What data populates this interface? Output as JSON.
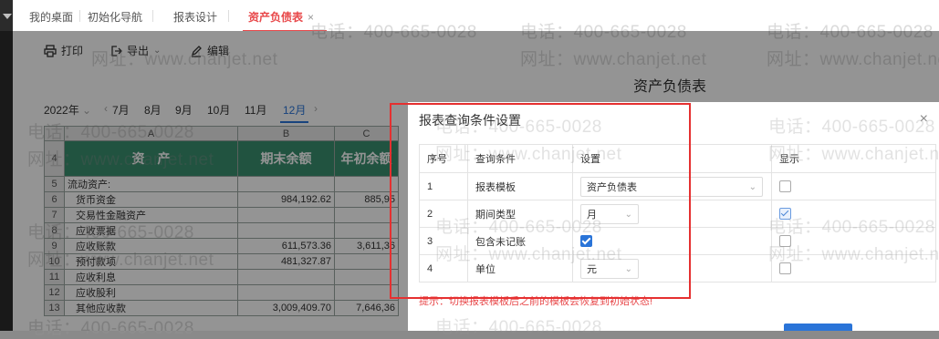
{
  "tabs": [
    {
      "label": "我的桌面"
    },
    {
      "label": "初始化导航"
    },
    {
      "label": "报表设计"
    },
    {
      "label": "资产负债表",
      "close": "×"
    }
  ],
  "toolbar": {
    "print_label": "打印",
    "export_label": "导出",
    "export_caret": "⌄",
    "edit_label": "编辑"
  },
  "report": {
    "title": "资产负债表"
  },
  "periods": {
    "year": "2022年",
    "year_caret": "⌄",
    "prev": "‹",
    "next": "›",
    "months": [
      "7月",
      "8月",
      "9月",
      "10月",
      "11月",
      "12月"
    ],
    "active_month": "12月"
  },
  "sheet": {
    "columns": [
      "A",
      "B",
      "C"
    ],
    "header_row_num": "4",
    "header": [
      "资　产",
      "期末余额",
      "年初余额"
    ],
    "rows": [
      {
        "num": "5",
        "a": "流动资产:",
        "b": "",
        "c": ""
      },
      {
        "num": "6",
        "a": "货币资金",
        "b": "984,192.62",
        "c": "885,95"
      },
      {
        "num": "7",
        "a": "交易性金融资产",
        "b": "",
        "c": ""
      },
      {
        "num": "8",
        "a": "应收票据",
        "b": "",
        "c": ""
      },
      {
        "num": "9",
        "a": "应收账款",
        "b": "611,573.36",
        "c": "3,611,36"
      },
      {
        "num": "10",
        "a": "预付款项",
        "b": "481,327.87",
        "c": ""
      },
      {
        "num": "11",
        "a": "应收利息",
        "b": "",
        "c": ""
      },
      {
        "num": "12",
        "a": "应收股利",
        "b": "",
        "c": ""
      },
      {
        "num": "13",
        "a": "其他应收款",
        "b": "3,009,409.70",
        "c": "7,646,36"
      }
    ]
  },
  "dialog": {
    "title": "报表查询条件设置",
    "close": "×",
    "headers": {
      "seq": "序号",
      "cond": "查询条件",
      "setting": "设置",
      "show": "显示"
    },
    "rows": [
      {
        "seq": "1",
        "cond": "报表模板",
        "value": "资产负债表"
      },
      {
        "seq": "2",
        "cond": "期间类型",
        "value": "月"
      },
      {
        "seq": "3",
        "cond": "包含未记账"
      },
      {
        "seq": "4",
        "cond": "单位",
        "value": "元"
      }
    ],
    "tip": "提示：切换报表模板后之前的模板会恢复到初始状态!"
  },
  "watermark": {
    "phone": "电话：400-665-0028",
    "site": "网址：www.chanjet.net"
  },
  "colors": {
    "accent_red": "#e8484a",
    "link_blue": "#2a74d8",
    "sheet_header_green": "#3a8f6f",
    "highlight_box": "#e53030"
  }
}
